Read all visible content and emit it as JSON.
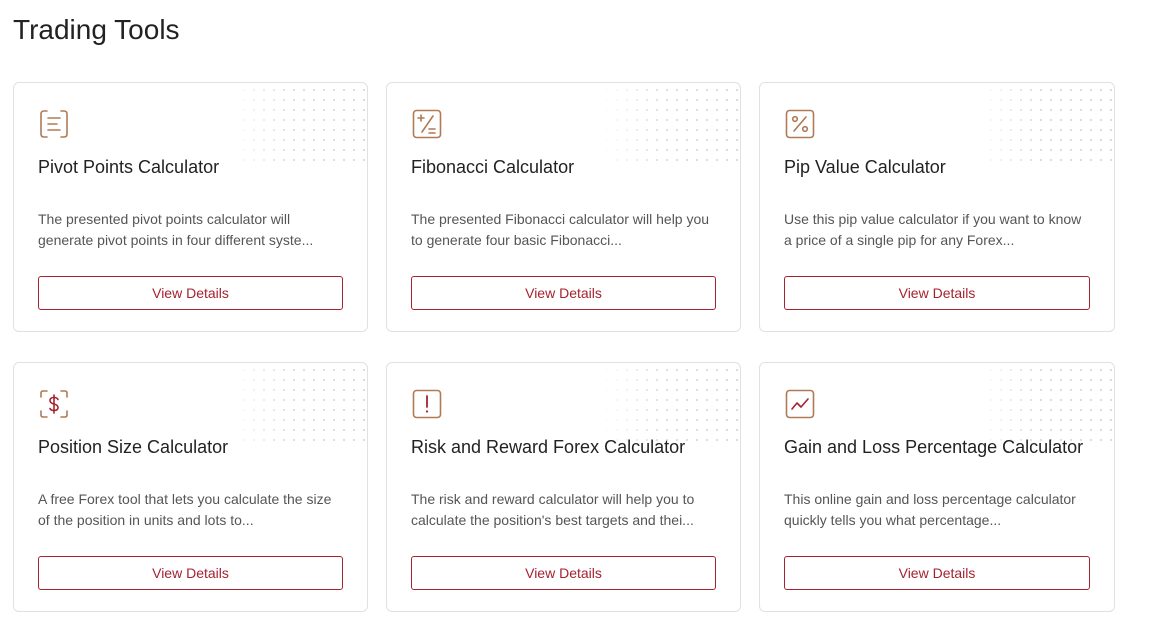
{
  "page": {
    "title": "Trading Tools"
  },
  "theme": {
    "accent": "#a5232f",
    "icon_color": "#b07a54"
  },
  "tools": [
    {
      "icon": "list-lines-icon",
      "title": "Pivot Points Calculator",
      "description": "The presented pivot points calculator will generate pivot points in four different syste...",
      "button_label": "View Details"
    },
    {
      "icon": "plus-minus-divide-icon",
      "title": "Fibonacci Calculator",
      "description": "The presented Fibonacci calculator will help you to generate four basic Fibonacci...",
      "button_label": "View Details"
    },
    {
      "icon": "percent-icon",
      "title": "Pip Value Calculator",
      "description": "Use this pip value calculator if you want to know a price of a single pip for any Forex...",
      "button_label": "View Details"
    },
    {
      "icon": "dollar-bracket-icon",
      "title": "Position Size Calculator",
      "description": "A free Forex tool that lets you calculate the size of the position in units and lots to...",
      "button_label": "View Details"
    },
    {
      "icon": "exclamation-icon",
      "title": "Risk and Reward Forex Calculator",
      "description": "The risk and reward calculator will help you to calculate the position's best targets and thei...",
      "button_label": "View Details"
    },
    {
      "icon": "trend-line-icon",
      "title": "Gain and Loss Percentage Calculator",
      "description": "This online gain and loss percentage calculator quickly tells you what percentage...",
      "button_label": "View Details"
    }
  ]
}
